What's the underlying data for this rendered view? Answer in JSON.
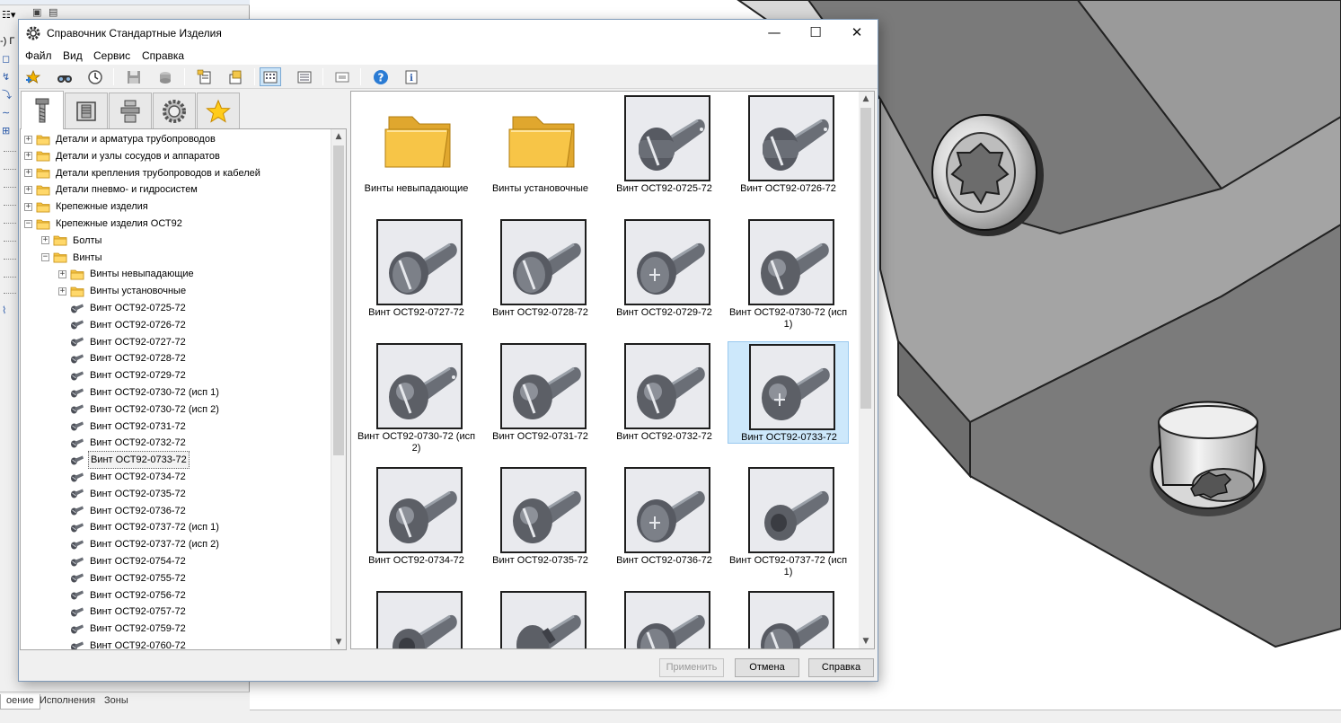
{
  "dialog": {
    "title": "Справочник Стандартные Изделия",
    "menu": [
      "Файл",
      "Вид",
      "Сервис",
      "Справка"
    ],
    "window_buttons": {
      "minimize": "—",
      "maximize": "☐",
      "close": "✕"
    }
  },
  "toolbar": {
    "buttons": [
      "add-favorite-icon",
      "find-icon",
      "history-icon",
      "save-icon",
      "drive-icon",
      "properties-icon",
      "export-icon",
      "icons-view-icon",
      "list-view-icon",
      "preview-icon",
      "help-icon",
      "info-icon"
    ],
    "active": "icons-view-icon"
  },
  "category_tabs": [
    "fasteners-tab-icon",
    "materials-tab-icon",
    "pipe-parts-tab-icon",
    "mechanical-parts-tab-icon",
    "favorites-tab-icon"
  ],
  "tree": {
    "items": [
      {
        "label": "Детали и арматура трубопроводов",
        "level": 0,
        "type": "folder",
        "expander": "+"
      },
      {
        "label": "Детали и узлы сосудов и аппаратов",
        "level": 0,
        "type": "folder",
        "expander": "+"
      },
      {
        "label": "Детали крепления трубопроводов и кабелей",
        "level": 0,
        "type": "folder",
        "expander": "+"
      },
      {
        "label": "Детали пневмо- и гидросистем",
        "level": 0,
        "type": "folder",
        "expander": "+"
      },
      {
        "label": "Крепежные изделия",
        "level": 0,
        "type": "folder",
        "expander": "+"
      },
      {
        "label": "Крепежные изделия ОСТ92",
        "level": 0,
        "type": "folder",
        "expander": "−"
      },
      {
        "label": "Болты",
        "level": 1,
        "type": "folder",
        "expander": "+"
      },
      {
        "label": "Винты",
        "level": 1,
        "type": "folder",
        "expander": "−"
      },
      {
        "label": "Винты невыпадающие",
        "level": 2,
        "type": "folder",
        "expander": "+"
      },
      {
        "label": "Винты установочные",
        "level": 2,
        "type": "folder",
        "expander": "+"
      },
      {
        "label": "Винт ОСТ92-0725-72",
        "level": 2,
        "type": "screw"
      },
      {
        "label": "Винт ОСТ92-0726-72",
        "level": 2,
        "type": "screw"
      },
      {
        "label": "Винт ОСТ92-0727-72",
        "level": 2,
        "type": "screw"
      },
      {
        "label": "Винт ОСТ92-0728-72",
        "level": 2,
        "type": "screw"
      },
      {
        "label": "Винт ОСТ92-0729-72",
        "level": 2,
        "type": "screw"
      },
      {
        "label": "Винт ОСТ92-0730-72 (исп 1)",
        "level": 2,
        "type": "screw"
      },
      {
        "label": "Винт ОСТ92-0730-72 (исп 2)",
        "level": 2,
        "type": "screw"
      },
      {
        "label": "Винт ОСТ92-0731-72",
        "level": 2,
        "type": "screw"
      },
      {
        "label": "Винт ОСТ92-0732-72",
        "level": 2,
        "type": "screw"
      },
      {
        "label": "Винт ОСТ92-0733-72",
        "level": 2,
        "type": "screw",
        "selected": true
      },
      {
        "label": "Винт ОСТ92-0734-72",
        "level": 2,
        "type": "screw"
      },
      {
        "label": "Винт ОСТ92-0735-72",
        "level": 2,
        "type": "screw"
      },
      {
        "label": "Винт ОСТ92-0736-72",
        "level": 2,
        "type": "screw"
      },
      {
        "label": "Винт ОСТ92-0737-72 (исп 1)",
        "level": 2,
        "type": "screw"
      },
      {
        "label": "Винт ОСТ92-0737-72 (исп 2)",
        "level": 2,
        "type": "screw"
      },
      {
        "label": "Винт ОСТ92-0754-72",
        "level": 2,
        "type": "screw"
      },
      {
        "label": "Винт ОСТ92-0755-72",
        "level": 2,
        "type": "screw"
      },
      {
        "label": "Винт ОСТ92-0756-72",
        "level": 2,
        "type": "screw"
      },
      {
        "label": "Винт ОСТ92-0757-72",
        "level": 2,
        "type": "screw"
      },
      {
        "label": "Винт ОСТ92-0759-72",
        "level": 2,
        "type": "screw"
      },
      {
        "label": "Винт ОСТ92-0760-72",
        "level": 2,
        "type": "screw"
      }
    ]
  },
  "grid": {
    "items": [
      {
        "label": "Винты невыпадающие",
        "type": "folder"
      },
      {
        "label": "Винты установочные",
        "type": "folder"
      },
      {
        "label": "Винт ОСТ92-0725-72",
        "type": "screw",
        "head": "cheese-slot-hole"
      },
      {
        "label": "Винт ОСТ92-0726-72",
        "type": "screw",
        "head": "cheese-slot-hole"
      },
      {
        "label": "Винт ОСТ92-0727-72",
        "type": "screw",
        "head": "countersunk-slot"
      },
      {
        "label": "Винт ОСТ92-0728-72",
        "type": "screw",
        "head": "countersunk-slot"
      },
      {
        "label": "Винт ОСТ92-0729-72",
        "type": "screw",
        "head": "countersunk-cross"
      },
      {
        "label": "Винт ОСТ92-0730-72 (исп 1)",
        "type": "screw",
        "head": "round-slot"
      },
      {
        "label": "Винт ОСТ92-0730-72 (исп 2)",
        "type": "screw",
        "head": "round-slot-hole"
      },
      {
        "label": "Винт ОСТ92-0731-72",
        "type": "screw",
        "head": "round-slot"
      },
      {
        "label": "Винт ОСТ92-0732-72",
        "type": "screw",
        "head": "round-slot"
      },
      {
        "label": "Винт ОСТ92-0733-72",
        "type": "screw",
        "head": "round-cross",
        "selected": true
      },
      {
        "label": "Винт ОСТ92-0734-72",
        "type": "screw",
        "head": "round-slot"
      },
      {
        "label": "Винт ОСТ92-0735-72",
        "type": "screw",
        "head": "round-slot"
      },
      {
        "label": "Винт ОСТ92-0736-72",
        "type": "screw",
        "head": "countersunk-cross"
      },
      {
        "label": "Винт ОСТ92-0737-72 (исп 1)",
        "type": "screw",
        "head": "socket"
      },
      {
        "label": "",
        "type": "screw",
        "head": "socket"
      },
      {
        "label": "",
        "type": "screw",
        "head": "grooved"
      },
      {
        "label": "",
        "type": "screw",
        "head": "countersunk-slot"
      },
      {
        "label": "",
        "type": "screw",
        "head": "countersunk-slot"
      }
    ]
  },
  "buttons": {
    "apply": "Применить",
    "cancel": "Отмена",
    "help": "Справка"
  },
  "background_app": {
    "top_fragment": "-) Г",
    "bottom_tabs": [
      "оение",
      "Исполнения",
      "Зоны"
    ]
  },
  "colors": {
    "folder": "#f5c242",
    "selection": "#cde8fb",
    "screw_metal": "#5c5f66",
    "model_gray": "#8a8a8a"
  }
}
